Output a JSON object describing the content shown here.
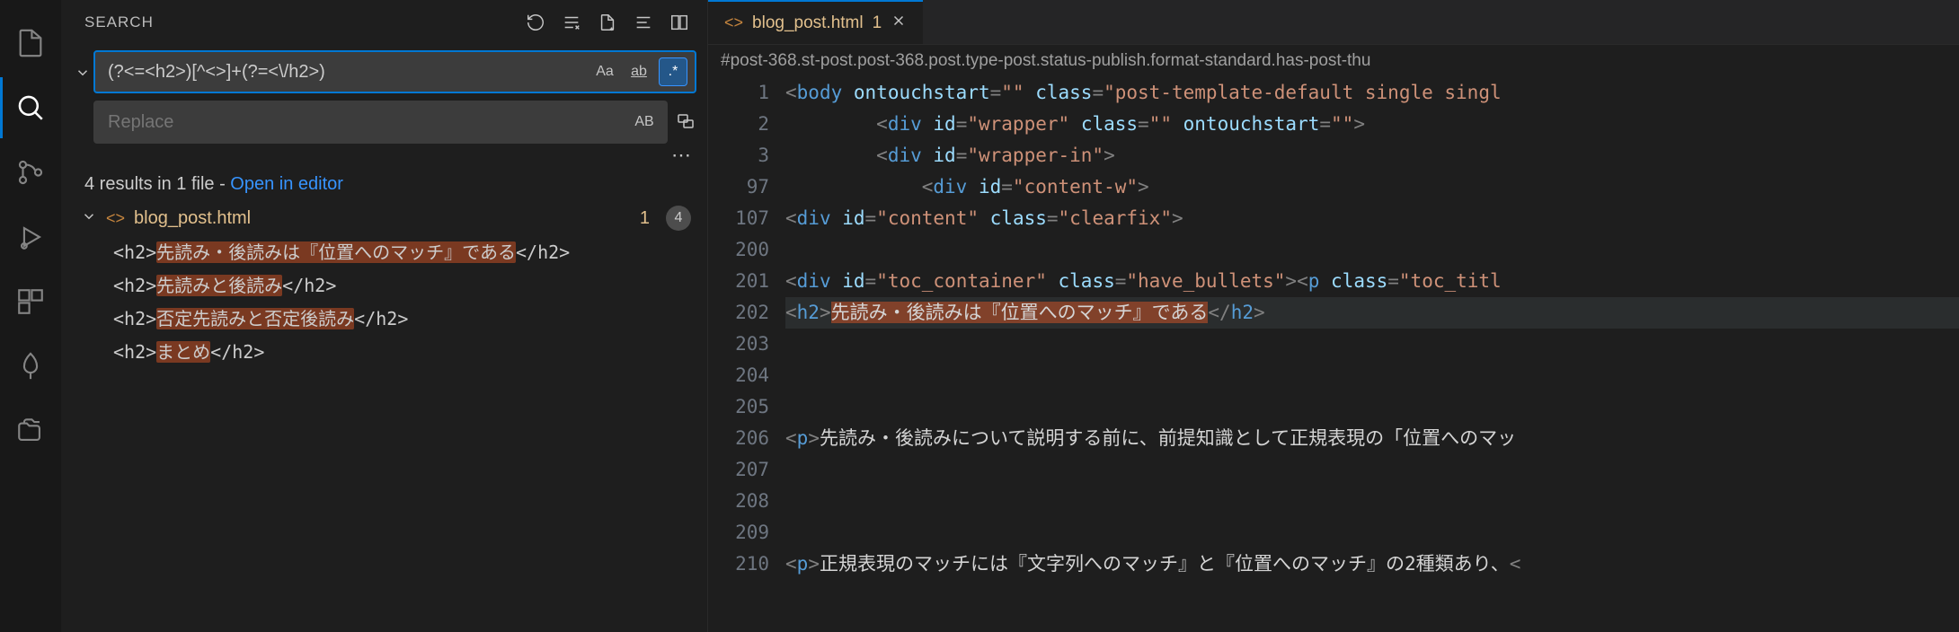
{
  "sidebar": {
    "title": "SEARCH",
    "search_value": "(?<=<h2>)[^<>]+(?=<\\/h2>)",
    "replace_placeholder": "Replace",
    "opts": {
      "case": "Aa",
      "word": "ab",
      "regex": ".*",
      "preserve": "AB"
    },
    "summary_prefix": "4 results in 1 file - ",
    "summary_link": "Open in editor",
    "file": {
      "name": "blog_post.html",
      "count_changed": "1",
      "badge": "4"
    },
    "results": [
      {
        "pre": "<h2>",
        "match": "先読み・後読みは『位置へのマッチ』である",
        "post": "</h2>"
      },
      {
        "pre": "<h2>",
        "match": "先読みと後読み",
        "post": "</h2>"
      },
      {
        "pre": "<h2>",
        "match": "否定先読みと否定後読み",
        "post": "</h2>"
      },
      {
        "pre": "<h2>",
        "match": "まとめ",
        "post": "</h2>"
      }
    ]
  },
  "editor": {
    "tab": {
      "name": "blog_post.html",
      "modified": "1"
    },
    "breadcrumb": "#post-368.st-post.post-368.post.type-post.status-publish.format-standard.has-post-thu",
    "gutter": [
      "1",
      "2",
      "3",
      "97",
      "107",
      "200",
      "201",
      "202",
      "203",
      "204",
      "205",
      "206",
      "207",
      "208",
      "209",
      "210"
    ],
    "lines": {
      "l1_body": "body",
      "l1_attr1": "ontouchstart",
      "l1_val1": "\"\"",
      "l1_attr2": "class",
      "l1_val2": "\"post-template-default single singl",
      "l2_tag": "div",
      "l2_attr1": "id",
      "l2_val1": "\"wrapper\"",
      "l2_attr2": "class",
      "l2_val2": "\"\"",
      "l2_attr3": "ontouchstart",
      "l2_val3": "\"\"",
      "l3_tag": "div",
      "l3_attr1": "id",
      "l3_val1": "\"wrapper-in\"",
      "l97_tag": "div",
      "l97_attr1": "id",
      "l97_val1": "\"content-w\"",
      "l107_tag": "div",
      "l107_attr1": "id",
      "l107_val1": "\"content\"",
      "l107_attr2": "class",
      "l107_val2": "\"clearfix\"",
      "l201_tag": "div",
      "l201_attr1": "id",
      "l201_val1": "\"toc_container\"",
      "l201_attr2": "class",
      "l201_val2": "\"have_bullets\"",
      "l201_tag2": "p",
      "l201_attr3": "class",
      "l201_val3": "\"toc_titl",
      "l202_tag": "h2",
      "l202_text": "先読み・後読みは『位置へのマッチ』である",
      "l206_tag": "p",
      "l206_text": "先読み・後読みについて説明する前に、前提知識として正規表現の「位置へのマッ",
      "l210_tag": "p",
      "l210_text": "正規表現のマッチには『文字列へのマッチ』と『位置へのマッチ』の2種類あり、"
    }
  }
}
